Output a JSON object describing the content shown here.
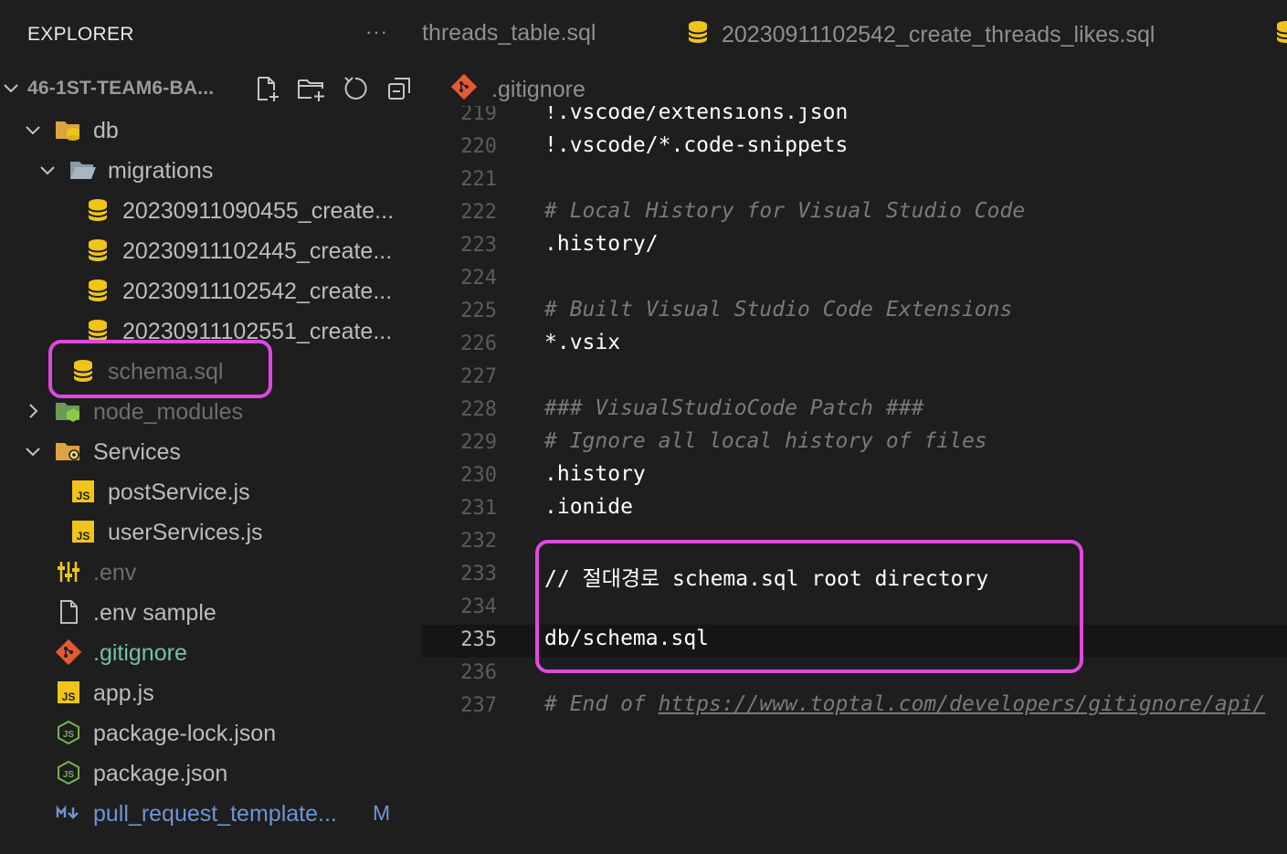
{
  "sidebar": {
    "title": "EXPLORER",
    "more": "···",
    "root": {
      "label": "46-1ST-TEAM6-BA...",
      "actions": [
        "new-file-icon",
        "new-folder-icon",
        "refresh-icon",
        "collapse-all-icon"
      ]
    },
    "tree": [
      {
        "label": "db",
        "icon": "database-folder-icon",
        "expanded": true
      },
      {
        "label": "migrations",
        "icon": "folder-open-icon",
        "expanded": true
      },
      {
        "label": "20230911090455_create...",
        "icon": "database-icon"
      },
      {
        "label": "20230911102445_create...",
        "icon": "database-icon"
      },
      {
        "label": "20230911102542_create...",
        "icon": "database-icon"
      },
      {
        "label": "20230911102551_create...",
        "icon": "database-icon"
      },
      {
        "label": "schema.sql",
        "icon": "database-icon",
        "ignored": true
      },
      {
        "label": "node_modules",
        "icon": "node-folder-icon",
        "expanded": false,
        "ignored": true
      },
      {
        "label": "Services",
        "icon": "services-folder-icon",
        "expanded": true
      },
      {
        "label": "postService.js",
        "icon": "js-file-icon"
      },
      {
        "label": "userServices.js",
        "icon": "js-file-icon"
      },
      {
        "label": ".env",
        "icon": "env-settings-icon",
        "ignored": true
      },
      {
        "label": ".env sample",
        "icon": "file-icon"
      },
      {
        "label": ".gitignore",
        "icon": "git-icon"
      },
      {
        "label": "app.js",
        "icon": "js-file-icon"
      },
      {
        "label": "package-lock.json",
        "icon": "nodejs-icon"
      },
      {
        "label": "package.json",
        "icon": "nodejs-icon"
      },
      {
        "label": "pull_request_template...",
        "icon": "markdown-icon",
        "badge": "M"
      }
    ]
  },
  "tabs": [
    {
      "label": "threads_table.sql",
      "icon": "database-icon"
    },
    {
      "label": "20230911102542_create_threads_likes.sql",
      "icon": "database-icon"
    },
    {
      "label": "",
      "icon": "database-icon"
    }
  ],
  "breadcrumb": {
    "label": ".gitignore",
    "icon": "git-icon"
  },
  "editor": {
    "current_line": 235,
    "lines": [
      {
        "n": "219",
        "text": "!.vscode/extensions.json",
        "kind": "code"
      },
      {
        "n": "220",
        "text": "!.vscode/*.code-snippets",
        "kind": "code"
      },
      {
        "n": "221",
        "text": "",
        "kind": "code"
      },
      {
        "n": "222",
        "text": "# Local History for Visual Studio Code",
        "kind": "comment"
      },
      {
        "n": "223",
        "text": ".history/",
        "kind": "code"
      },
      {
        "n": "224",
        "text": "",
        "kind": "code"
      },
      {
        "n": "225",
        "text": "# Built Visual Studio Code Extensions",
        "kind": "comment"
      },
      {
        "n": "226",
        "text": "*.vsix",
        "kind": "code"
      },
      {
        "n": "227",
        "text": "",
        "kind": "code"
      },
      {
        "n": "228",
        "text": "### VisualStudioCode Patch ###",
        "kind": "comment"
      },
      {
        "n": "229",
        "text": "# Ignore all local history of files",
        "kind": "comment"
      },
      {
        "n": "230",
        "text": ".history",
        "kind": "code"
      },
      {
        "n": "231",
        "text": ".ionide",
        "kind": "code"
      },
      {
        "n": "232",
        "text": "",
        "kind": "code"
      },
      {
        "n": "233",
        "text": "// 절대경로 schema.sql root directory",
        "kind": "code"
      },
      {
        "n": "234",
        "text": "",
        "kind": "code"
      },
      {
        "n": "235",
        "text": "db/schema.sql",
        "kind": "code"
      },
      {
        "n": "236",
        "text": "",
        "kind": "code"
      },
      {
        "n": "237",
        "text": "# End of ",
        "url": "https://www.toptal.com/developers/gitignore/api/",
        "kind": "comment"
      }
    ]
  },
  "colors": {
    "background": "#1e1e1e",
    "highlight": "#e048e0",
    "db_icon": "#f0c419",
    "git_icon": "#e45a33",
    "js_icon": "#f0c419",
    "node_icon": "#79b05a",
    "markdown": "#6f94d6"
  }
}
